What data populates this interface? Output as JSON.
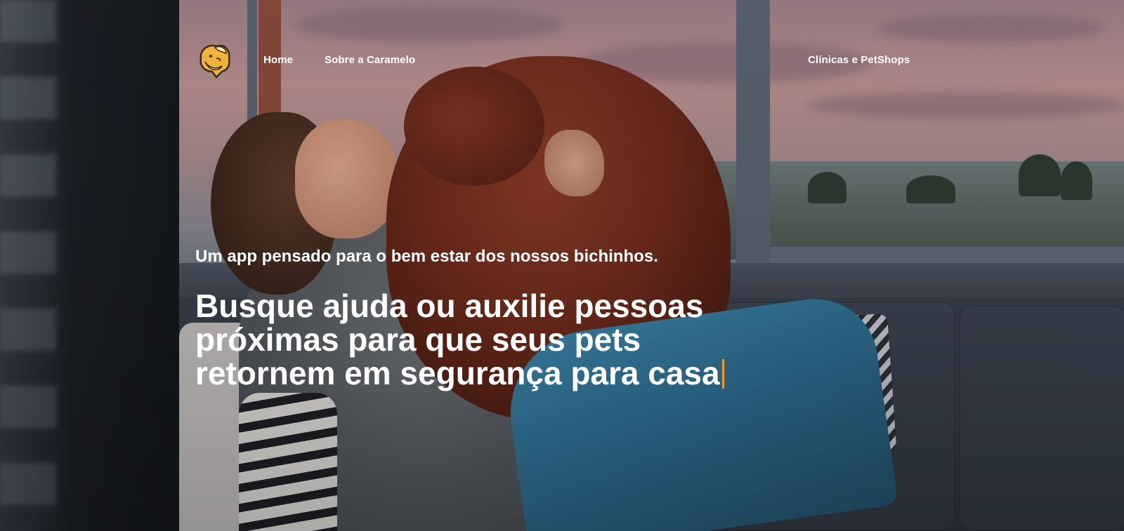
{
  "brand": {
    "logo_icon": "caramelo-dog-logo-icon",
    "accent_color": "#e6a035",
    "logo_colors": {
      "primary": "#f0b43c",
      "secondary": "#ffe6b0",
      "outline": "#3a2a1a"
    }
  },
  "nav": {
    "items": [
      {
        "label": "Home"
      },
      {
        "label": "Sobre a Caramelo"
      },
      {
        "label": "Clínicas e PetShops"
      }
    ]
  },
  "hero": {
    "subtitle": "Um app pensado para o bem estar dos nossos bichinhos.",
    "headline": "Busque ajuda ou auxilie pessoas próximas para que seus pets retornem em segurança para casa",
    "text_color": "#ffffff",
    "background_image": "woman-kissing-curly-brown-dog-on-sofa-photo"
  }
}
